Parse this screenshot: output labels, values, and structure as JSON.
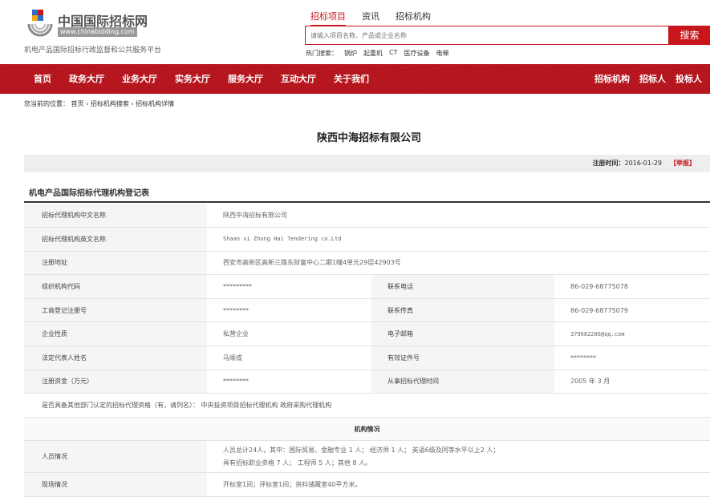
{
  "header": {
    "logo_title": "中国国际招标网",
    "logo_url": "www.chinabidding.com",
    "logo_subtitle": "机电产品国际招标行政监督和公共服务平台",
    "search_tabs": [
      "招标项目",
      "资讯",
      "招标机构"
    ],
    "search_placeholder": "请输入项目名称、产品或企业名称",
    "search_button": "搜索",
    "hot_label": "热门搜索：",
    "hot_items": [
      "锅炉",
      "起重机",
      "CT",
      "医疗设备",
      "电梯"
    ]
  },
  "nav": {
    "left": [
      "首页",
      "政务大厅",
      "业务大厅",
      "实务大厅",
      "服务大厅",
      "互动大厅",
      "关于我们"
    ],
    "right": [
      "招标机构",
      "招标人",
      "投标人"
    ]
  },
  "breadcrumb": "您当前的位置： 首页 › 招标机构搜索 › 招标机构详情",
  "company_title": "陕西中海招标有限公司",
  "registration": {
    "label": "注册时间：",
    "date": "2016-01-29",
    "report": "【举报】"
  },
  "section_title": "机电产品国际招标代理机构登记表",
  "rows": {
    "cn_name_k": "招标代理机构中文名称",
    "cn_name_v": "陕西中海招标有限公司",
    "en_name_k": "招标代理机构英文名称",
    "en_name_v": "Shaan xi Zhong Hai Tendering co.Ltd",
    "addr_k": "注册地址",
    "addr_v": "西安市高新区高新三路东财富中心二期1幢4单元29层42903号",
    "org_k": "组织机构代码",
    "org_v": "*********",
    "tel_k": "联系电话",
    "tel_v": "86-029-68775078",
    "biz_k": "工商登记注册号",
    "biz_v": "********",
    "fax_k": "联系传真",
    "fax_v": "86-029-68775079",
    "nature_k": "企业性质",
    "nature_v": "私营企业",
    "email_k": "电子邮箱",
    "email_v": "379682206@qq.com",
    "legal_k": "法定代表人姓名",
    "legal_v": "马顺成",
    "id_k": "有效证件号",
    "id_v": "********",
    "capital_k": "注册资金（万元）",
    "capital_v": "********",
    "since_k": "从事招标代理时间",
    "since_v": "2005 年 3 月",
    "other_qual": "是否具备其他部门认定的招标代理资格（有，请列名）：  中央投资项目招标代理机构 政府采购代理机构",
    "org_section": "机构情况",
    "staff_k": "人员情况",
    "staff_v1": "人员总计24人，其中：国际贸易、金融专业 1 人；  经济师 1 人；  英语6级及同等水平以上2 人；",
    "staff_v2": "具有招标职业资格 7 人；  工程师 5 人；其他 8 人。",
    "site_k": "现场情况",
    "site_v": "开标室1间；评标室1间；资料储藏室40平方米。"
  },
  "colors": {
    "brand_red": "#c8161d",
    "nav_red": "#b4121a"
  }
}
